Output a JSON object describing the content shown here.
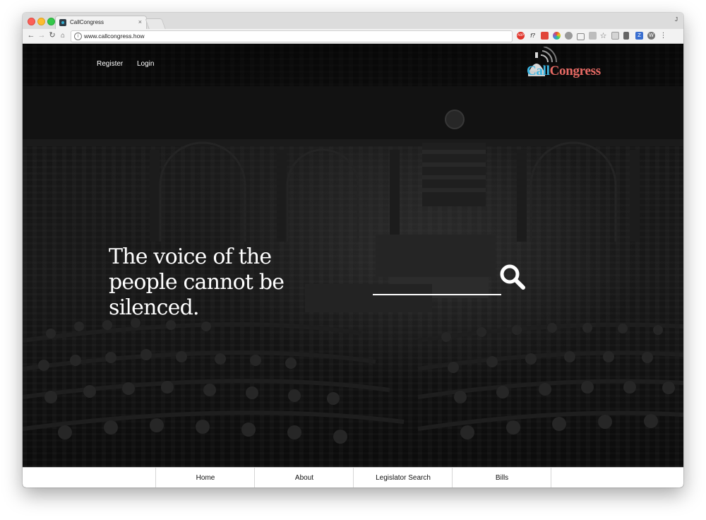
{
  "browser": {
    "tab_title": "CallCongress",
    "tab_close": "×",
    "url": "www.callcongress.how",
    "profile_initial": "J",
    "info_symbol": "i",
    "extensions": [
      "abp-icon",
      "font-icon",
      "pocket-icon",
      "color-picker-icon",
      "extension-icon",
      "camera-icon",
      "extension-icon",
      "star-icon",
      "reader-icon",
      "notes-icon",
      "z-icon",
      "wp-icon",
      "menu-icon"
    ],
    "ext_labels": {
      "abp": "ABP",
      "font": "f?",
      "z": "Z",
      "wp": "W"
    }
  },
  "page": {
    "nav": {
      "register": "Register",
      "login": "Login"
    },
    "logo": {
      "call": "Call",
      "congress": "Congress"
    },
    "headline": [
      "The voice of the",
      "people cannot be",
      "silenced."
    ],
    "search": {
      "value": "",
      "placeholder": ""
    },
    "colors": {
      "call": "#3cb6e3",
      "congress": "#e76a64",
      "background": "#0a0a0a"
    }
  },
  "bottom_nav": [
    {
      "label": "Home"
    },
    {
      "label": "About"
    },
    {
      "label": "Legislator Search"
    },
    {
      "label": "Bills"
    }
  ]
}
